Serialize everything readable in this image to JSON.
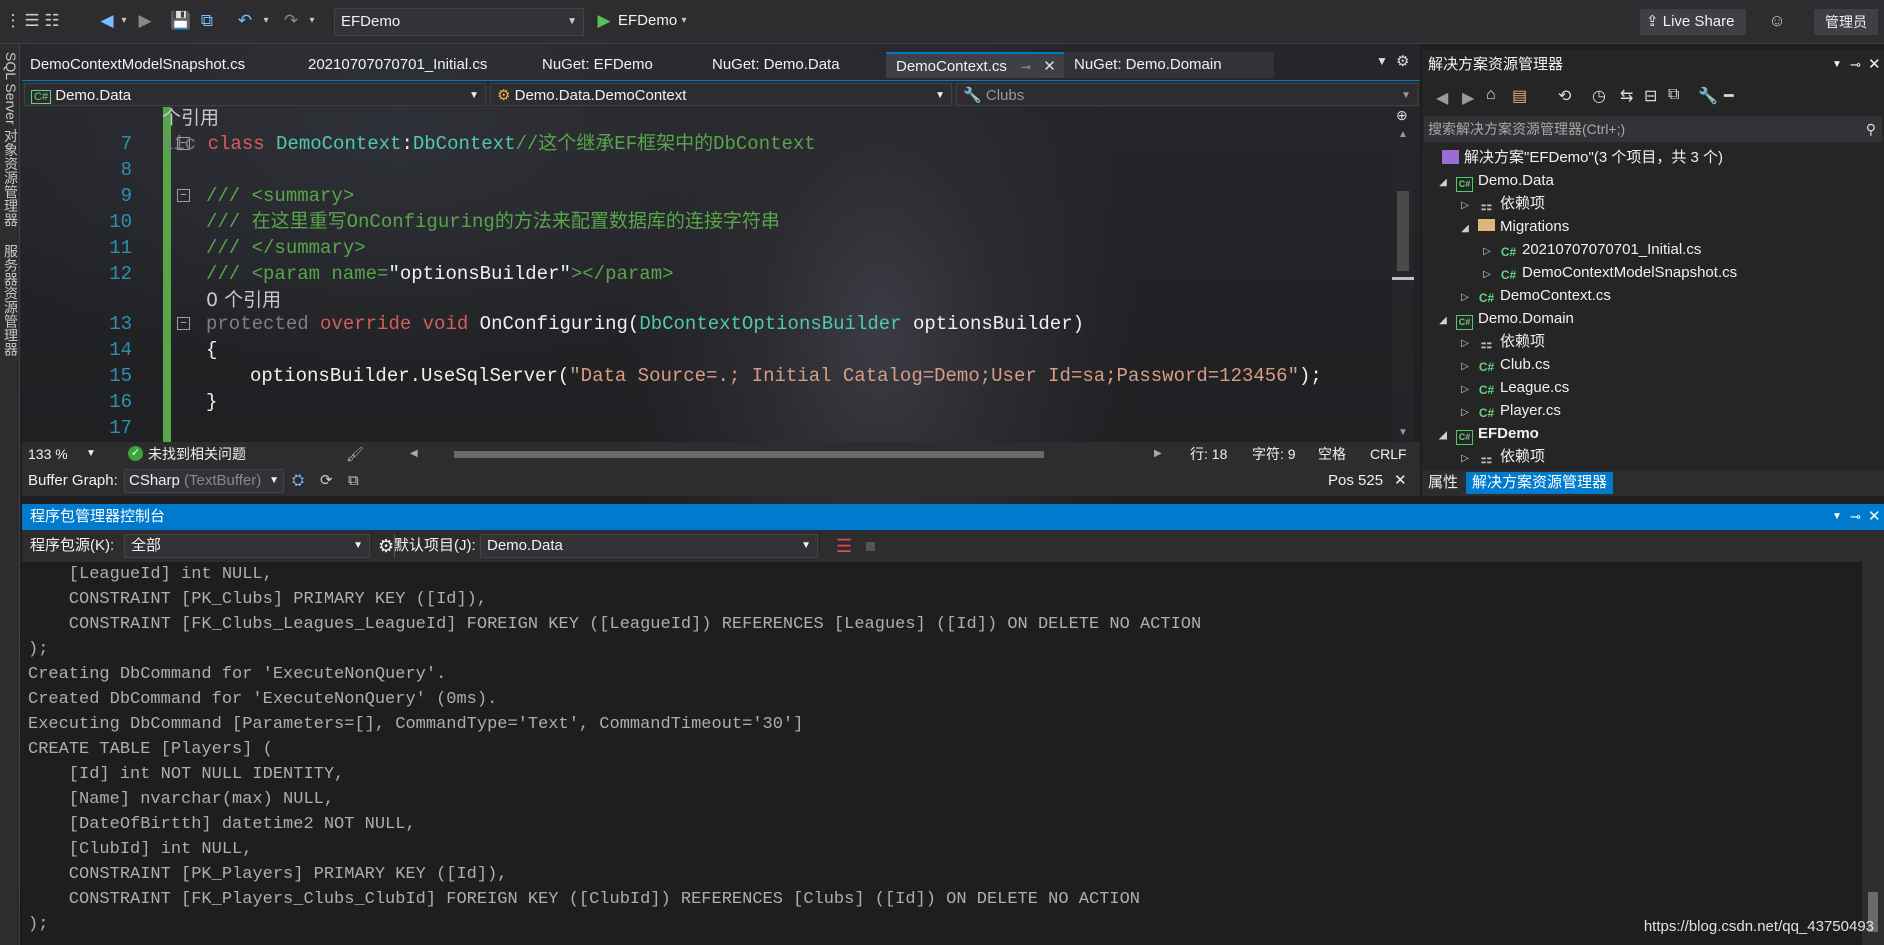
{
  "toolbar": {
    "solution_config": "EFDemo",
    "start_label": "EFDemo",
    "live_share": "Live Share",
    "admin": "管理员"
  },
  "sidebar_vertical": {
    "item1": "SQL Server 对象资源管理器",
    "item2": "服务器资源管理器"
  },
  "tabs": [
    {
      "label": "DemoContextModelSnapshot.cs"
    },
    {
      "label": "20210707070701_Initial.cs"
    },
    {
      "label": "NuGet: EFDemo"
    },
    {
      "label": "NuGet: Demo.Data"
    },
    {
      "label": "DemoContext.cs"
    },
    {
      "label": "NuGet: Demo.Domain"
    }
  ],
  "navbar": {
    "project": "Demo.Data",
    "class": "Demo.Data.DemoContext",
    "member": "Clubs"
  },
  "editor": {
    "ref1": "个引用",
    "line7_a": "lic ",
    "line7_kw": "class ",
    "line7_ty": "DemoContext",
    "line7_b": ":",
    "line7_ty2": "DbContext",
    "line7_cm": "//这个继承EF框架中的DbContext",
    "line9": "/// <summary>",
    "line10": "/// 在这里重写OnConfiguring的方法来配置数据库的连接字符串",
    "line11": "/// </summary>",
    "line12_a": "/// <param name=",
    "line12_b": "\"optionsBuilder\"",
    "line12_c": "></param>",
    "ref2": "0 个引用",
    "line13_a": "protected ",
    "line13_kw": "override void ",
    "line13_fn": "OnConfiguring",
    "line13_p": "(",
    "line13_ty": "DbContextOptionsBuilder",
    "line13_arg": " optionsBuilder)",
    "line14": "{",
    "line15_a": "optionsBuilder.UseSqlServer(",
    "line15_str": "\"Data Source=.; Initial Catalog=Demo;User Id=sa;Password=123456\"",
    "line15_b": ");",
    "line16": "}",
    "line_numbers": [
      "7",
      "8",
      "9",
      "10",
      "11",
      "12",
      "13",
      "14",
      "15",
      "16",
      "17"
    ]
  },
  "status": {
    "zoom": "133 %",
    "issues": "未找到相关问题",
    "row": "行: 18",
    "col": "字符: 9",
    "space": "空格",
    "eol": "CRLF"
  },
  "buffer": {
    "label": "Buffer Graph:",
    "value": "CSharp",
    "value2": "(TextBuffer)",
    "pos": "Pos 525"
  },
  "solution_explorer": {
    "title": "解决方案资源管理器",
    "search_placeholder": "搜索解决方案资源管理器(Ctrl+;)",
    "items": [
      {
        "label": "解决方案\"EFDemo\"(3 个项目，共 3 个)"
      },
      {
        "label": "Demo.Data"
      },
      {
        "label": "依赖项"
      },
      {
        "label": "Migrations"
      },
      {
        "label": "20210707070701_Initial.cs"
      },
      {
        "label": "DemoContextModelSnapshot.cs"
      },
      {
        "label": "DemoContext.cs"
      },
      {
        "label": "Demo.Domain"
      },
      {
        "label": "依赖项"
      },
      {
        "label": "Club.cs"
      },
      {
        "label": "League.cs"
      },
      {
        "label": "Player.cs"
      },
      {
        "label": "EFDemo"
      },
      {
        "label": "依赖项"
      }
    ],
    "footer_tab1": "属性",
    "footer_tab2": "解决方案资源管理器"
  },
  "package_manager": {
    "title": "程序包管理器控制台",
    "source_label": "程序包源(K):",
    "source_value": "全部",
    "default_label": "默认项目(J):",
    "default_value": "Demo.Data",
    "lines": [
      "    [LeagueId] int NULL,",
      "    CONSTRAINT [PK_Clubs] PRIMARY KEY ([Id]),",
      "    CONSTRAINT [FK_Clubs_Leagues_LeagueId] FOREIGN KEY ([LeagueId]) REFERENCES [Leagues] ([Id]) ON DELETE NO ACTION",
      ");",
      "Creating DbCommand for 'ExecuteNonQuery'.",
      "Created DbCommand for 'ExecuteNonQuery' (0ms).",
      "Executing DbCommand [Parameters=[], CommandType='Text', CommandTimeout='30']",
      "CREATE TABLE [Players] (",
      "    [Id] int NOT NULL IDENTITY,",
      "    [Name] nvarchar(max) NULL,",
      "    [DateOfBirtth] datetime2 NOT NULL,",
      "    [ClubId] int NULL,",
      "    CONSTRAINT [PK_Players] PRIMARY KEY ([Id]),",
      "    CONSTRAINT [FK_Players_Clubs_ClubId] FOREIGN KEY ([ClubId]) REFERENCES [Clubs] ([Id]) ON DELETE NO ACTION",
      ");"
    ]
  },
  "watermark": "https://blog.csdn.net/qq_43750493"
}
